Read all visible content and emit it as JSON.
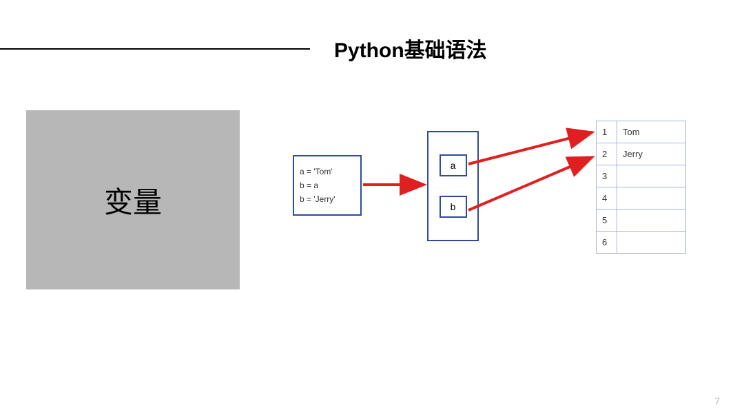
{
  "title": "Python基础语法",
  "graybox": {
    "label": "变量"
  },
  "code": {
    "line1": "a = 'Tom'",
    "line2": "b = a",
    "line3": "b = 'Jerry'"
  },
  "vars": {
    "a": "a",
    "b": "b"
  },
  "memory": [
    {
      "idx": "1",
      "val": "Tom"
    },
    {
      "idx": "2",
      "val": "Jerry"
    },
    {
      "idx": "3",
      "val": ""
    },
    {
      "idx": "4",
      "val": ""
    },
    {
      "idx": "5",
      "val": ""
    },
    {
      "idx": "6",
      "val": ""
    }
  ],
  "page_number": "7"
}
